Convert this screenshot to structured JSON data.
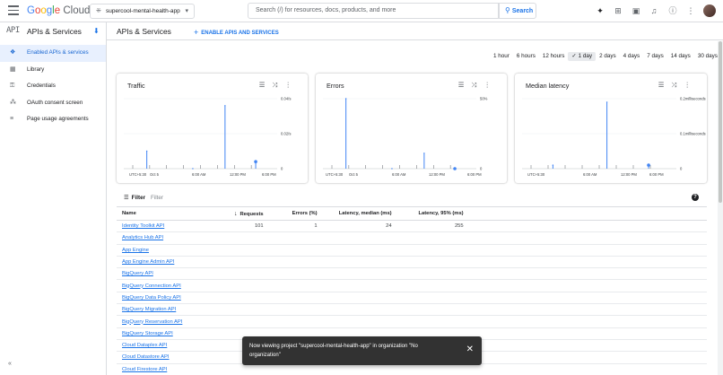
{
  "topbar": {
    "logo_google": "Google",
    "logo_cloud": "Cloud",
    "project": "supercool-mental-health-app",
    "search_placeholder": "Search (/) for resources, docs, products, and more",
    "search_button": "Search"
  },
  "sidebar": {
    "product_icon": "API",
    "title": "APIs & Services",
    "items": [
      {
        "label": "Enabled APIs & services",
        "icon": "diamond-icon",
        "active": true
      },
      {
        "label": "Library",
        "icon": "library-icon"
      },
      {
        "label": "Credentials",
        "icon": "key-icon"
      },
      {
        "label": "OAuth consent screen",
        "icon": "consent-icon"
      },
      {
        "label": "Page usage agreements",
        "icon": "settings-icon"
      }
    ]
  },
  "main": {
    "title": "APIs & Services",
    "enable_button": "ENABLE APIS AND SERVICES"
  },
  "time_ranges": [
    "1 hour",
    "6 hours",
    "12 hours",
    "1 day",
    "2 days",
    "4 days",
    "7 days",
    "14 days",
    "30 days"
  ],
  "selected_range": "1 day",
  "charts": {
    "traffic": {
      "title": "Traffic",
      "y_ticks": [
        "0.04/s",
        "0.02/s",
        "0"
      ]
    },
    "errors": {
      "title": "Errors",
      "y_ticks": [
        "50%",
        "0"
      ]
    },
    "latency": {
      "title": "Median latency",
      "y_ticks": [
        "0.2milliseconds",
        "0.1milliseconds",
        "0"
      ]
    },
    "x_ticks": [
      "UTC+5:30",
      "Oct 5",
      "6:00 AM",
      "12:00 PM",
      "6:00 PM"
    ],
    "x_ticks_latency": [
      "UTC+5:30",
      "6:00 AM",
      "12:00 PM",
      "6:00 PM"
    ]
  },
  "chart_data": [
    {
      "type": "line",
      "title": "Traffic",
      "ylim": [
        0,
        0.04
      ],
      "y_unit": "/s",
      "x": [
        "Oct 5",
        "6:00 AM",
        "12:00 PM",
        "6:00 PM"
      ],
      "series": [
        {
          "values": [
            0.01,
            0,
            0.036,
            0.004
          ]
        }
      ]
    },
    {
      "type": "line",
      "title": "Errors",
      "ylim": [
        0,
        50
      ],
      "y_unit": "%",
      "x": [
        "Oct 5",
        "6:00 AM",
        "12:00 PM",
        "6:00 PM"
      ],
      "series": [
        {
          "values": [
            50,
            0,
            11,
            0
          ]
        }
      ]
    },
    {
      "type": "line",
      "title": "Median latency",
      "ylim": [
        0,
        0.2
      ],
      "y_unit": "milliseconds",
      "x": [
        "6:00 AM",
        "12:00 PM",
        "6:00 PM"
      ],
      "series": [
        {
          "values": [
            0.01,
            0.19,
            0.01
          ]
        }
      ]
    }
  ],
  "filter": {
    "label": "Filter",
    "placeholder": "Filter"
  },
  "table": {
    "headers": {
      "name": "Name",
      "requests": "Requests",
      "errors": "Errors (%)",
      "latency_median": "Latency, median (ms)",
      "latency_95": "Latency, 95% (ms)"
    },
    "rows": [
      {
        "name": "Identity Toolkit API",
        "requests": "101",
        "errors": "1",
        "median": "24",
        "p95": "255"
      },
      {
        "name": "Analytics Hub API",
        "requests": "",
        "errors": "",
        "median": "",
        "p95": ""
      },
      {
        "name": "App Engine",
        "requests": "",
        "errors": "",
        "median": "",
        "p95": ""
      },
      {
        "name": "App Engine Admin API",
        "requests": "",
        "errors": "",
        "median": "",
        "p95": ""
      },
      {
        "name": "BigQuery API",
        "requests": "",
        "errors": "",
        "median": "",
        "p95": ""
      },
      {
        "name": "BigQuery Connection API",
        "requests": "",
        "errors": "",
        "median": "",
        "p95": ""
      },
      {
        "name": "BigQuery Data Policy API",
        "requests": "",
        "errors": "",
        "median": "",
        "p95": ""
      },
      {
        "name": "BigQuery Migration API",
        "requests": "",
        "errors": "",
        "median": "",
        "p95": ""
      },
      {
        "name": "BigQuery Reservation API",
        "requests": "",
        "errors": "",
        "median": "",
        "p95": ""
      },
      {
        "name": "BigQuery Storage API",
        "requests": "",
        "errors": "",
        "median": "",
        "p95": ""
      },
      {
        "name": "Cloud Dataplex API",
        "requests": "",
        "errors": "",
        "median": "",
        "p95": ""
      },
      {
        "name": "Cloud Datastore API",
        "requests": "",
        "errors": "",
        "median": "",
        "p95": ""
      },
      {
        "name": "Cloud Firestore API",
        "requests": "",
        "errors": "",
        "median": "",
        "p95": ""
      }
    ]
  },
  "snackbar": {
    "message": "Now viewing project \"supercool-mental-health-app\" in organization \"No organization\""
  },
  "colors": {
    "accent": "#1a73e8",
    "series": "#4285f4"
  }
}
